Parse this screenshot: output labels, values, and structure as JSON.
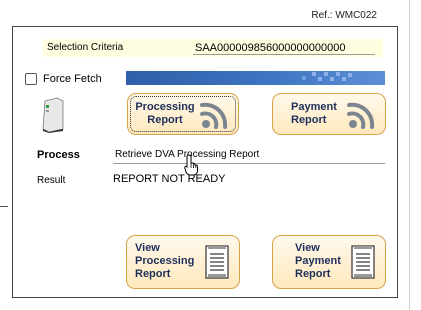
{
  "ref": "Ref.: WMC022",
  "criteria": {
    "label": "Selection Criteria",
    "value": "SAA000009856000000000000"
  },
  "force_fetch": {
    "label": "Force Fetch",
    "checked": false
  },
  "buttons": {
    "processing_report": "Processing\nReport",
    "payment_report": "Payment\nReport",
    "view_processing_report": "View\nProcessing\nReport",
    "view_payment_report": "View\nPayment\nReport"
  },
  "process": {
    "label": "Process",
    "value": "Retrieve DVA Processing Report"
  },
  "result": {
    "label": "Result",
    "value": "REPORT NOT READY"
  },
  "icons": {
    "status_device": "device-status-icon",
    "wireless_report": "wireless-signal-icon",
    "report_document": "report-document-icon",
    "cursor": "hand-pointer-cursor"
  },
  "colors": {
    "button_border": "#d7a24a",
    "button_fill": "#ffe8bd",
    "button_text": "#1e2f5a",
    "progress": "#2f5fa8",
    "criteria_bg": "#fffde0"
  }
}
